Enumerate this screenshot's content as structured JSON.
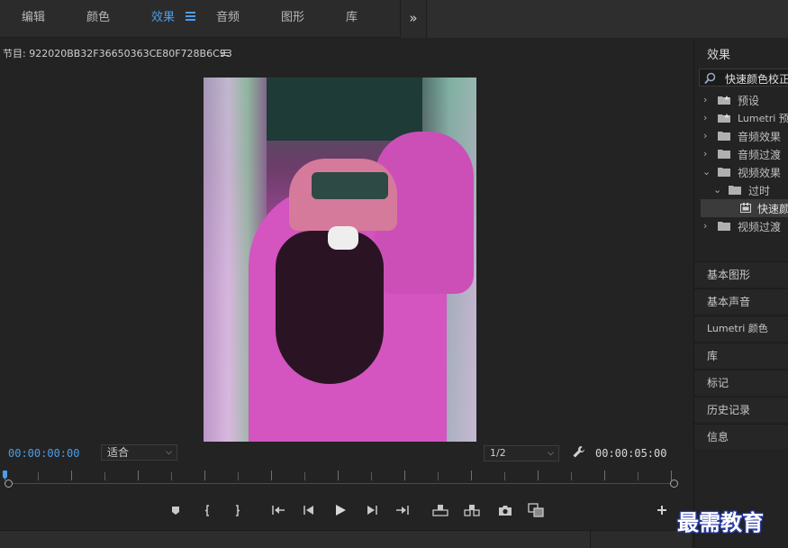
{
  "workspace_tabs": [
    {
      "label": "编辑",
      "active": false
    },
    {
      "label": "颜色",
      "active": false
    },
    {
      "label": "效果",
      "active": true
    },
    {
      "label": "音频",
      "active": false
    },
    {
      "label": "图形",
      "active": false
    },
    {
      "label": "库",
      "active": false
    }
  ],
  "workspace_overflow": "»",
  "monitor": {
    "title": "节目: 922020BB32F36650363CE80F728B6C93",
    "current_timecode": "00:00:00:00",
    "duration_timecode": "00:00:05:00",
    "fit_select": "适合",
    "resolution_select": "1/2"
  },
  "effects_panel": {
    "title": "效果",
    "search_value": "快速颜色校正",
    "tree": [
      {
        "label": "预设",
        "level": 0,
        "expanded": false,
        "type": "preset-folder"
      },
      {
        "label": "Lumetri 预",
        "level": 0,
        "expanded": false,
        "type": "preset-folder"
      },
      {
        "label": "音频效果",
        "level": 0,
        "expanded": false,
        "type": "folder"
      },
      {
        "label": "音频过渡",
        "level": 0,
        "expanded": false,
        "type": "folder"
      },
      {
        "label": "视频效果",
        "level": 0,
        "expanded": true,
        "type": "folder"
      },
      {
        "label": "过时",
        "level": 1,
        "expanded": true,
        "type": "folder"
      },
      {
        "label": "快速颜",
        "level": 2,
        "expanded": false,
        "type": "effect",
        "selected": true
      },
      {
        "label": "视频过渡",
        "level": 0,
        "expanded": false,
        "type": "folder"
      }
    ]
  },
  "right_panels": [
    "基本图形",
    "基本声音",
    "Lumetri 颜色",
    "库",
    "标记",
    "历史记录",
    "信息"
  ],
  "watermark": "最需教育",
  "colors": {
    "accent": "#4a9eea",
    "background": "#232323",
    "panel": "#2b2b2b"
  },
  "icons": {
    "controls": [
      "marker-icon",
      "mark-in-icon",
      "mark-out-icon",
      "go-to-in-icon",
      "step-back-icon",
      "play-icon",
      "step-forward-icon",
      "go-to-out-icon",
      "lift-icon",
      "extract-icon",
      "export-frame-icon",
      "comparison-view-icon",
      "add-button-icon"
    ]
  }
}
